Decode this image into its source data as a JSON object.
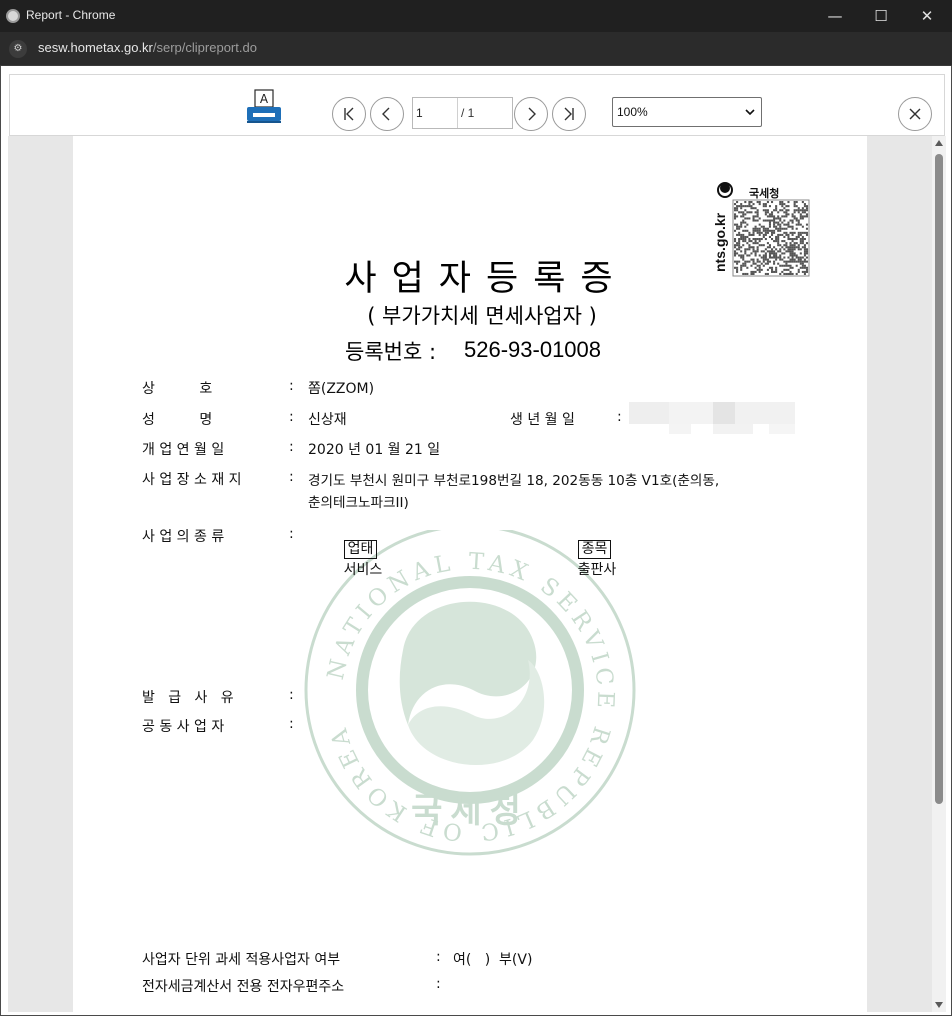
{
  "window": {
    "title": "Report - Chrome",
    "url_host": "sesw.hometax.go.kr",
    "url_path": "/serp/clipreport.do",
    "minimize": "—",
    "maximize": "☐",
    "close": "✕"
  },
  "toolbar": {
    "print_icon": "printer-icon",
    "current_page": "1",
    "total_pages": "/ 1",
    "zoom": "100%",
    "zoom_options": [
      "100%"
    ]
  },
  "document": {
    "title": "사업자등록증",
    "subtitle": "( 부가가치세 면세사업자 )",
    "reg_label": "등록번호 :",
    "reg_number": "526-93-01008",
    "logo_text": "국세청",
    "logo_url": "nts.go.kr",
    "fields": {
      "trade_name_label": "상          호",
      "trade_name": "쫌(ZZOM)",
      "name_label": "성          명",
      "name": "신상재",
      "birth_label": "생 년 월 일",
      "opening_label": "개 업 연 월 일",
      "opening_date": "2020 년 01 월 21 일",
      "address_label": "사 업 장 소 재 지",
      "address_line1": "경기도 부천시 원미구 부천로198번길 18, 202동동 10층 V1호(춘의동,",
      "address_line2": "춘의테크노파크II)",
      "business_label": "사 업 의 종 류",
      "biz_type_tag": "업태",
      "biz_type": "서비스",
      "biz_item_tag": "종목",
      "biz_item": "출판사",
      "issue_reason_label": "발   급   사   유",
      "co_owner_label": "공 동 사 업 자",
      "unit_tax_label": "사업자 단위 과세 적용사업자 여부",
      "unit_tax_value": "여(   )  부(V)",
      "email_label": "전자세금계산서 전용 전자우편주소"
    },
    "seal": {
      "ring_text": "NATIONAL TAX SERVICE REPUBLIC OF KOREA",
      "center_text": "국세청"
    }
  },
  "colors": {
    "seal": "#c9dccf",
    "titlebar": "#202020",
    "viewport": "#e7e7e7",
    "print_blue": "#1e6fb8"
  }
}
